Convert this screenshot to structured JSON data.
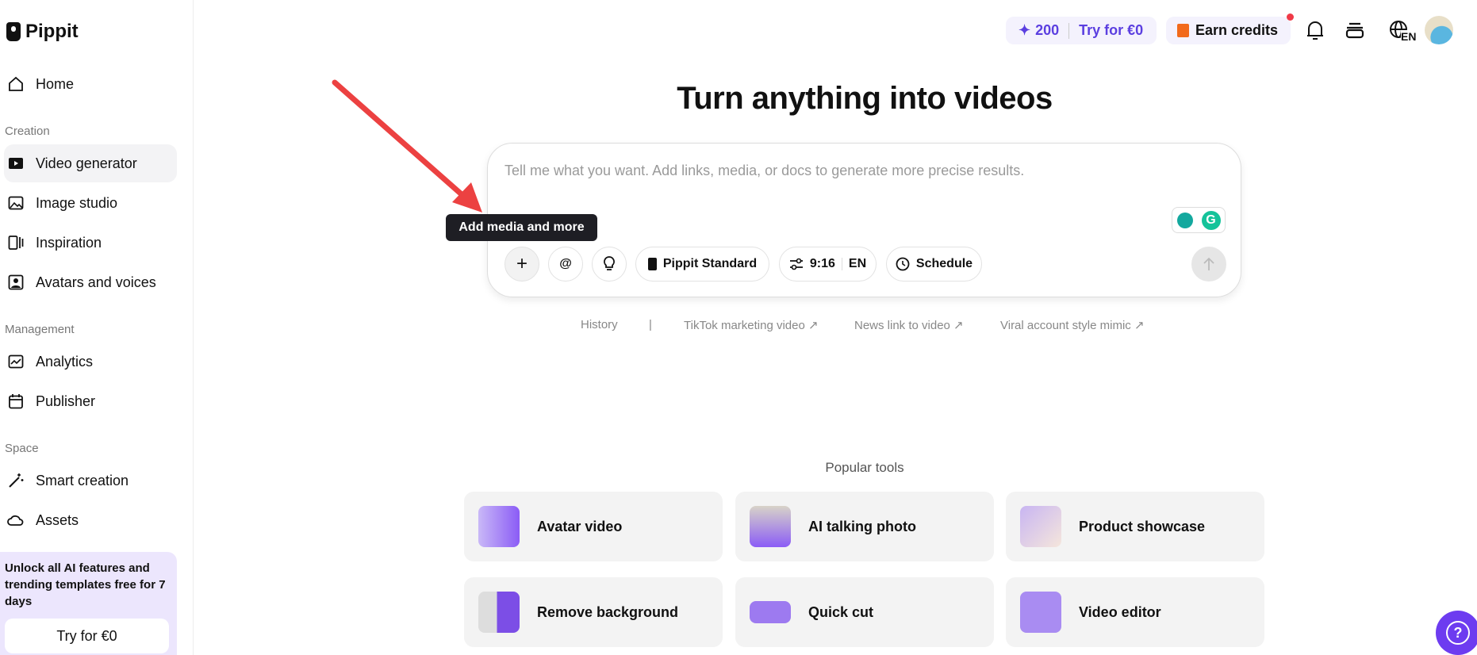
{
  "brand": "Pippit",
  "sidebar": {
    "home": "Home",
    "sections": {
      "creation": "Creation",
      "management": "Management",
      "space": "Space"
    },
    "items": [
      {
        "label": "Video generator",
        "icon": "video-generator-icon"
      },
      {
        "label": "Image studio",
        "icon": "image-icon"
      },
      {
        "label": "Inspiration",
        "icon": "inspiration-icon"
      },
      {
        "label": "Avatars and voices",
        "icon": "avatar-icon"
      },
      {
        "label": "Analytics",
        "icon": "analytics-icon"
      },
      {
        "label": "Publisher",
        "icon": "calendar-icon"
      },
      {
        "label": "Smart creation",
        "icon": "magic-wand-icon"
      },
      {
        "label": "Assets",
        "icon": "cloud-icon"
      }
    ],
    "promo": {
      "text": "Unlock all AI features and trending templates free for 7 days",
      "button": "Try for €0"
    }
  },
  "header": {
    "credits": "200",
    "try": "Try for €0",
    "earn": "Earn credits",
    "lang": "EN",
    "accent": "#5b3fe0"
  },
  "main": {
    "title": "Turn anything into videos",
    "placeholder": "Tell me what you want. Add links, media, or docs to generate more precise results.",
    "tooltip": "Add media and more",
    "toolbar": {
      "model": "Pippit Standard",
      "ratio": "9:16",
      "lang": "EN",
      "schedule": "Schedule",
      "at": "@"
    },
    "links": {
      "history": "History",
      "sep": "|",
      "l1": "TikTok marketing video ↗",
      "l2": "News link to video ↗",
      "l3": "Viral account style mimic ↗"
    },
    "popular_title": "Popular tools",
    "tools": [
      "Avatar video",
      "AI talking photo",
      "Product showcase",
      "Remove background",
      "Quick cut",
      "Video editor"
    ]
  }
}
